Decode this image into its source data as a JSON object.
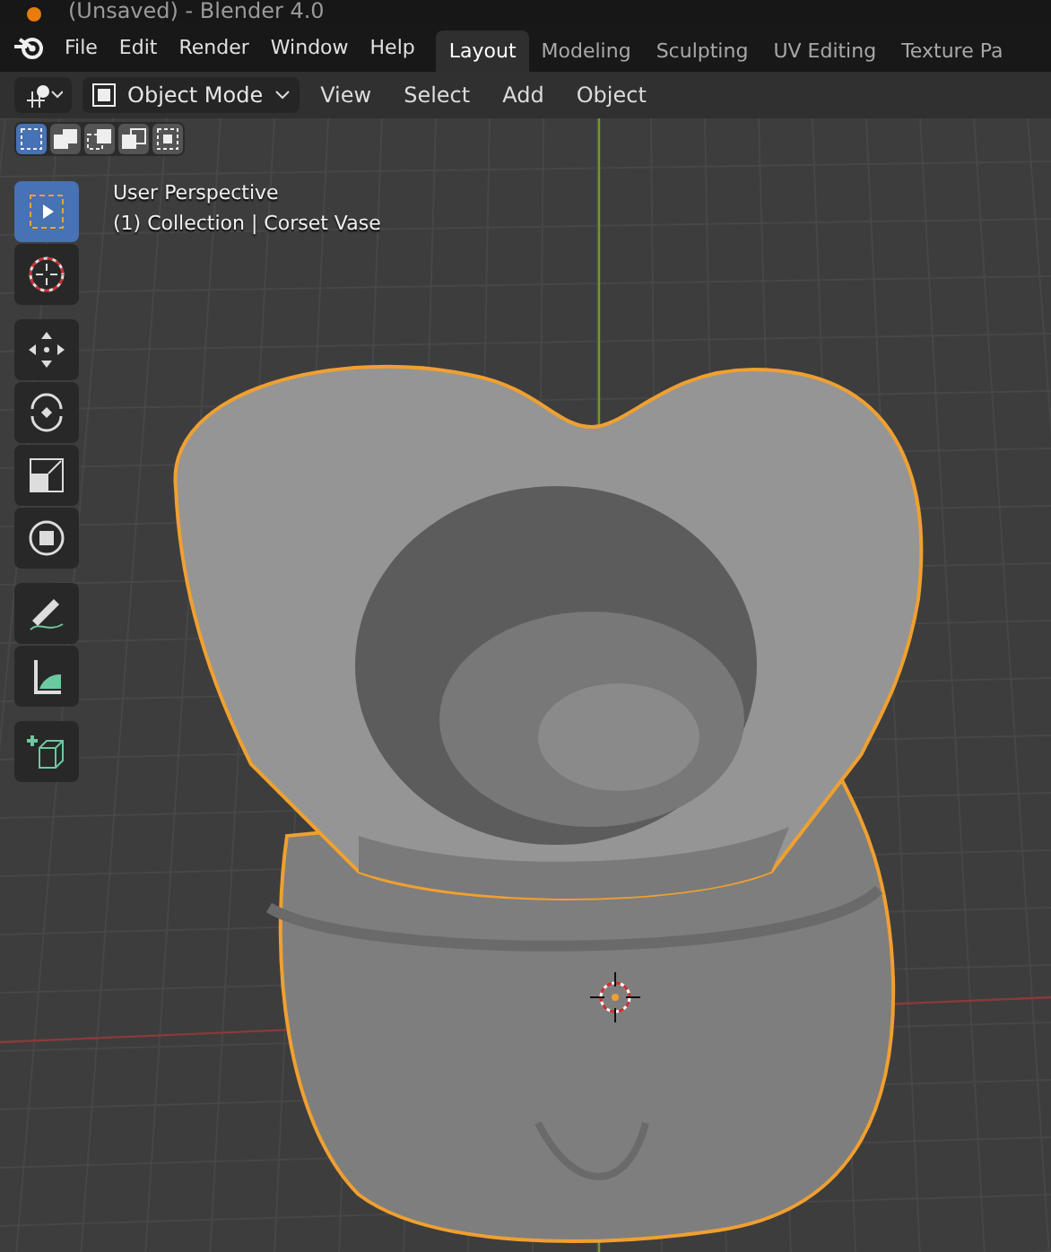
{
  "window": {
    "title": "(Unsaved) - Blender 4.0"
  },
  "menu": [
    "File",
    "Edit",
    "Render",
    "Window",
    "Help"
  ],
  "workspaces": [
    {
      "label": "Layout",
      "selected": true
    },
    {
      "label": "Modeling",
      "selected": false
    },
    {
      "label": "Sculpting",
      "selected": false
    },
    {
      "label": "UV Editing",
      "selected": false
    },
    {
      "label": "Texture Pa",
      "selected": false
    }
  ],
  "header": {
    "mode": "Object Mode",
    "menus": [
      "View",
      "Select",
      "Add",
      "Object"
    ]
  },
  "select_modes": [
    {
      "kind": "set",
      "selected": true
    },
    {
      "kind": "extend",
      "selected": false
    },
    {
      "kind": "subtract",
      "selected": false
    },
    {
      "kind": "difference",
      "selected": false
    },
    {
      "kind": "intersect",
      "selected": false
    }
  ],
  "tool_groups": [
    [
      {
        "kind": "select",
        "selected": true
      },
      {
        "kind": "cursor",
        "selected": false
      }
    ],
    [
      {
        "kind": "move",
        "selected": false
      },
      {
        "kind": "rotate",
        "selected": false
      },
      {
        "kind": "scale",
        "selected": false
      },
      {
        "kind": "transform",
        "selected": false
      }
    ],
    [
      {
        "kind": "annotate",
        "selected": false
      },
      {
        "kind": "measure",
        "selected": false
      }
    ],
    [
      {
        "kind": "add",
        "selected": false
      }
    ]
  ],
  "viewport": {
    "view": "User Perspective",
    "object": "(1) Collection | Corset Vase"
  }
}
